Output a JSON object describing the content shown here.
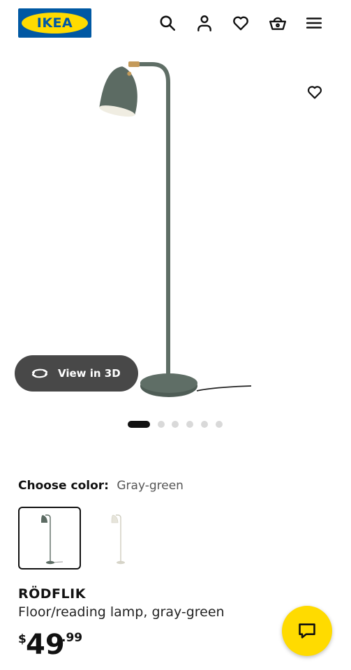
{
  "header": {
    "logo_text": "IKEA",
    "icons": [
      "search-icon",
      "account-icon",
      "favorites-icon",
      "cart-icon",
      "menu-icon"
    ]
  },
  "gallery": {
    "view_3d_label": "View in 3D",
    "image_count": 6,
    "active_image": 1
  },
  "colors": {
    "accent_yellow": "#ffdb00",
    "brand_blue": "#0058a3",
    "lamp_gray_green": "#5c6b63",
    "lamp_white": "#e6e4da"
  },
  "color_chooser": {
    "label": "Choose color:",
    "selected": "Gray-green",
    "options": [
      "Gray-green",
      "White"
    ]
  },
  "product": {
    "name": "RÖDFLIK",
    "description": "Floor/reading lamp, gray-green",
    "price": {
      "currency": "$",
      "integer": "49",
      "decimal": ".99"
    }
  }
}
